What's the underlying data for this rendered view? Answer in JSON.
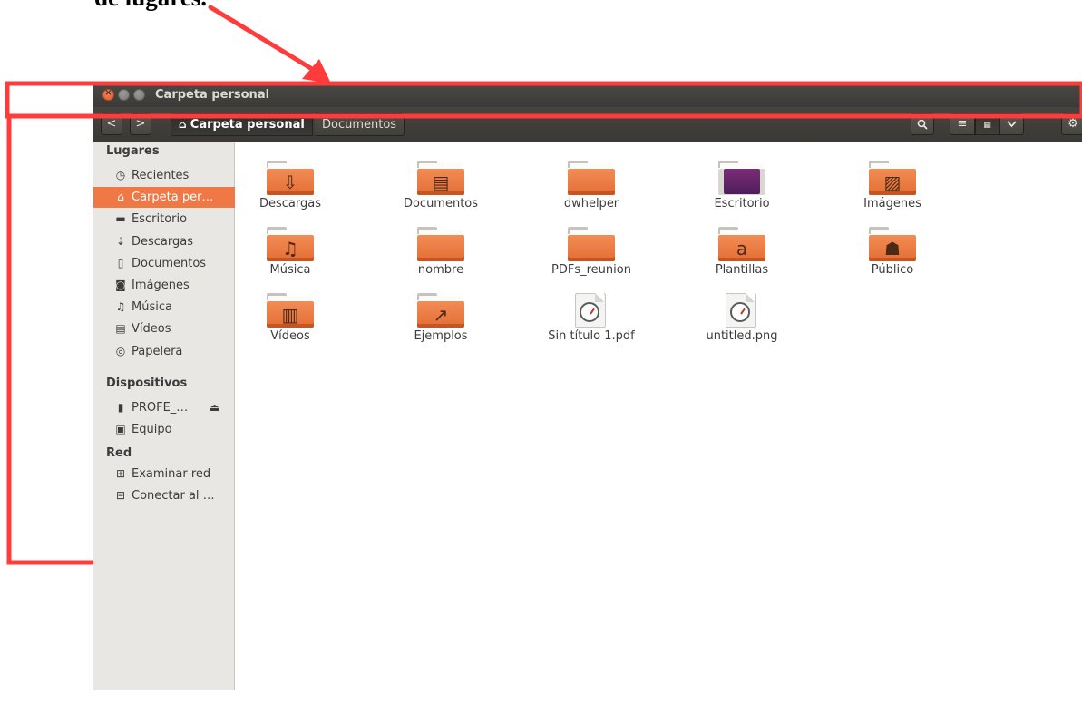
{
  "caption": "de lugares.",
  "window": {
    "title": "Carpeta personal"
  },
  "toolbar": {
    "back_label": "<",
    "forward_label": ">",
    "home_crumb": "Carpeta personal",
    "next_crumb": "Documentos",
    "search_icon": "search-icon",
    "list_icon": "list-view-icon",
    "grid_icon": "grid-view-icon",
    "menu_icon": "chevron-down-icon",
    "settings_icon": "gear-icon"
  },
  "sidebar": {
    "sections": [
      {
        "title": "Lugares"
      },
      {
        "title": "Dispositivos"
      },
      {
        "title": "Red"
      }
    ],
    "places": [
      {
        "label": "Recientes",
        "icon": "clock-icon",
        "glyph": "◷"
      },
      {
        "label": "Carpeta per…",
        "icon": "home-icon",
        "glyph": "⌂",
        "selected": true
      },
      {
        "label": "Escritorio",
        "icon": "desktop-folder-icon",
        "glyph": "▬"
      },
      {
        "label": "Descargas",
        "icon": "download-icon",
        "glyph": "⇣"
      },
      {
        "label": "Documentos",
        "icon": "document-icon",
        "glyph": "▯"
      },
      {
        "label": "Imágenes",
        "icon": "camera-icon",
        "glyph": "◙"
      },
      {
        "label": "Música",
        "icon": "music-icon",
        "glyph": "♫"
      },
      {
        "label": "Vídeos",
        "icon": "film-icon",
        "glyph": "▤"
      },
      {
        "label": "Papelera",
        "icon": "trash-icon",
        "glyph": "◎"
      }
    ],
    "devices": [
      {
        "label": "PROFE_…",
        "icon": "usb-drive-icon",
        "glyph": "▮",
        "eject": "⏏"
      },
      {
        "label": "Equipo",
        "icon": "computer-icon",
        "glyph": "▣"
      }
    ],
    "network": [
      {
        "label": "Examinar red",
        "icon": "network-icon",
        "glyph": "⊞"
      },
      {
        "label": "Conectar al …",
        "icon": "connect-server-icon",
        "glyph": "⊟"
      }
    ]
  },
  "files": [
    {
      "name": "Descargas",
      "kind": "folder",
      "emblem": "⇩"
    },
    {
      "name": "Documentos",
      "kind": "folder",
      "emblem": "▤"
    },
    {
      "name": "dwhelper",
      "kind": "folder",
      "emblem": ""
    },
    {
      "name": "Escritorio",
      "kind": "desktop",
      "emblem": ""
    },
    {
      "name": "Imágenes",
      "kind": "folder",
      "emblem": "▨"
    },
    {
      "name": "Música",
      "kind": "folder",
      "emblem": "♫"
    },
    {
      "name": "nombre",
      "kind": "folder",
      "emblem": ""
    },
    {
      "name": "PDFs_reunion",
      "kind": "folder",
      "emblem": ""
    },
    {
      "name": "Plantillas",
      "kind": "folder",
      "emblem": "a"
    },
    {
      "name": "Público",
      "kind": "folder",
      "emblem": "☗"
    },
    {
      "name": "Vídeos",
      "kind": "folder",
      "emblem": "▥"
    },
    {
      "name": "Ejemplos",
      "kind": "folder",
      "emblem": "↗"
    },
    {
      "name": "Sin título 1.pdf",
      "kind": "document",
      "emblem": ""
    },
    {
      "name": "untitled.png",
      "kind": "document",
      "emblem": ""
    }
  ],
  "colors": {
    "annotation": "#ff3b3b",
    "selection": "#f07746",
    "folder": "#e9773c",
    "toolbar": "#3f3e3a"
  }
}
